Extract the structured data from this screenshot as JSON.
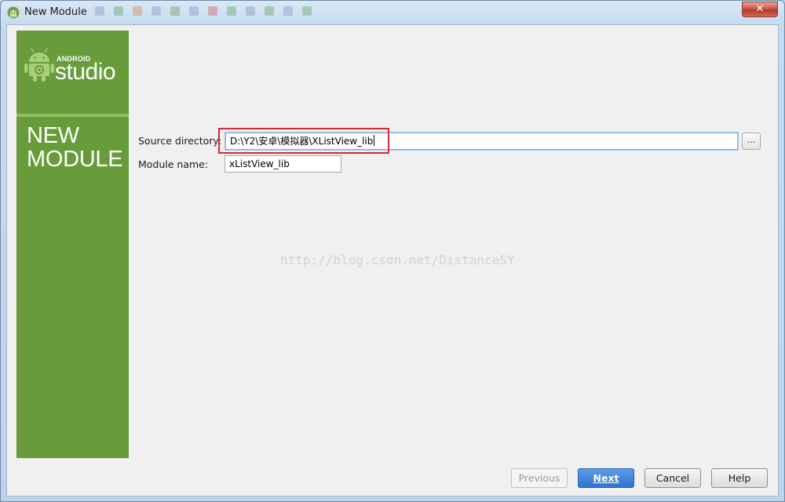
{
  "window": {
    "title": "New Module",
    "close_label": "✕"
  },
  "sidebar": {
    "logo_small": "ANDROID",
    "logo_big": "studio",
    "heading_line1": "NEW",
    "heading_line2": "MODULE",
    "accent_color": "#689c3b"
  },
  "form": {
    "source_directory": {
      "label": "Source directory:",
      "value": "D:\\Y2\\安卓\\模拟器\\XListView_lib"
    },
    "browse_label": "...",
    "module_name": {
      "label": "Module name:",
      "value": "xListView_lib"
    }
  },
  "watermark": "http://blog.csdn.net/DistanceSY",
  "buttons": {
    "previous": "Previous",
    "next": "Next",
    "cancel": "Cancel",
    "help": "Help"
  }
}
